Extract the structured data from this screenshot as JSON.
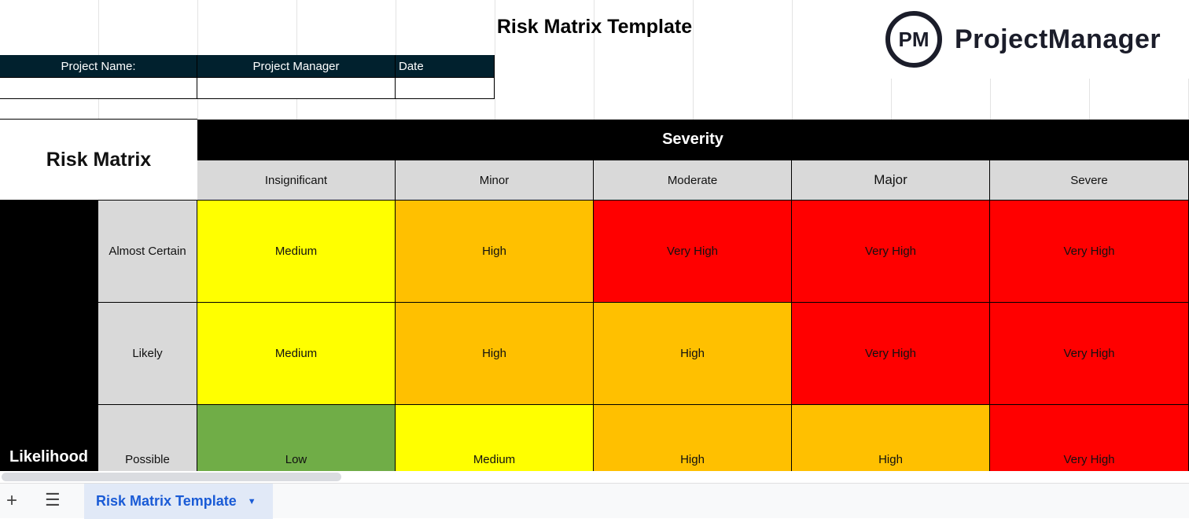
{
  "title": "Risk Matrix Template",
  "logo": {
    "mark": "PM",
    "name": "ProjectManager"
  },
  "project_header": {
    "name_label": "Project Name:",
    "manager_label": "Project Manager",
    "date_label": "Date",
    "name_value": "",
    "manager_value": "",
    "date_value": ""
  },
  "matrix": {
    "title": "Risk Matrix",
    "severity_label": "Severity",
    "likelihood_label": "Likelihood",
    "severity_levels": [
      "Insignificant",
      "Minor",
      "Moderate",
      "Major",
      "Severe"
    ],
    "rows": [
      {
        "likelihood": "Almost Certain",
        "cells": [
          "Medium",
          "High",
          "Very High",
          "Very High",
          "Very High"
        ]
      },
      {
        "likelihood": "Likely",
        "cells": [
          "Medium",
          "High",
          "High",
          "Very High",
          "Very High"
        ]
      },
      {
        "likelihood": "Possible",
        "cells": [
          "Low",
          "Medium",
          "High",
          "High",
          "Very High"
        ]
      }
    ],
    "colors": {
      "Low": "#70ad47",
      "Medium": "#ffff00",
      "High": "#ffc000",
      "Very High": "#ff0000"
    }
  },
  "tabs": {
    "add_icon": "plus-icon",
    "menu_icon": "menu-icon",
    "active": "Risk Matrix Template"
  }
}
